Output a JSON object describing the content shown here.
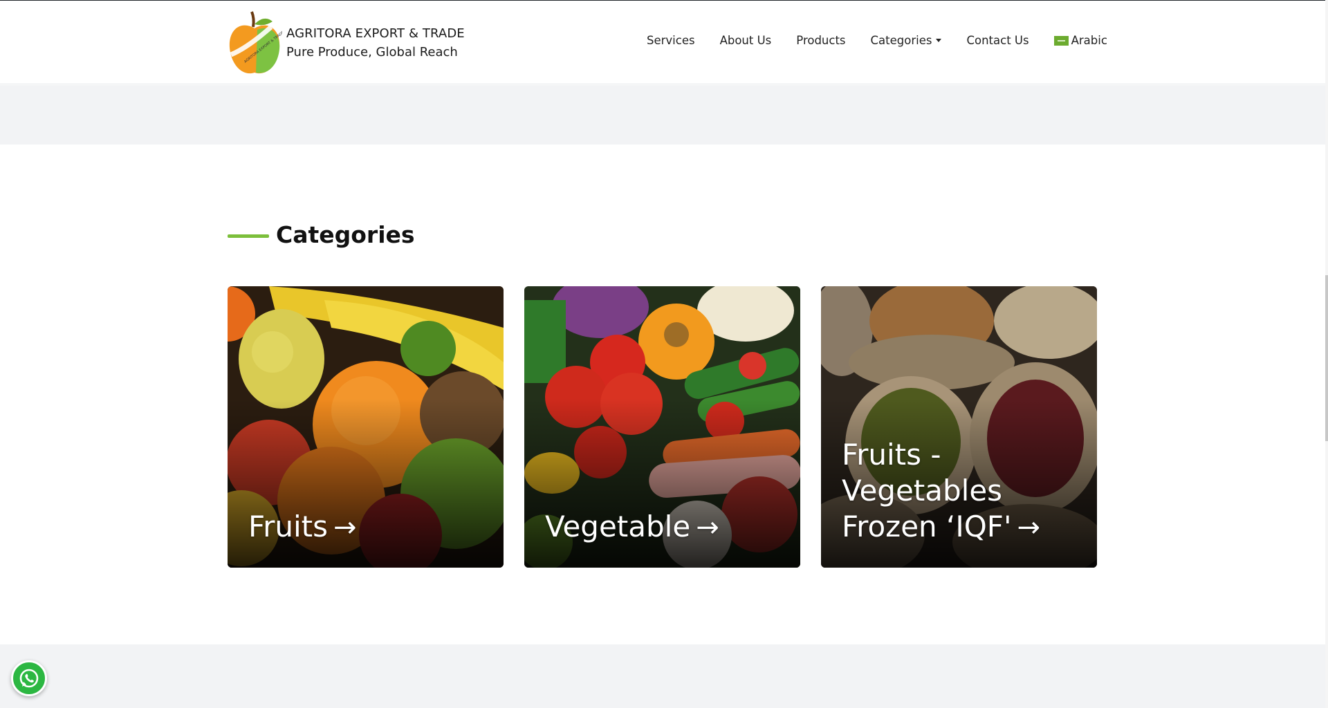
{
  "header": {
    "brand_name": "AGRITORA EXPORT & TRADE",
    "brand_tagline": "Pure Produce, Global Reach",
    "logo_text": "AGRITORA EXPORT & TRADE"
  },
  "nav": {
    "items": [
      {
        "label": "Services"
      },
      {
        "label": "About Us"
      },
      {
        "label": "Products"
      },
      {
        "label": "Categories"
      },
      {
        "label": "Contact Us"
      },
      {
        "label": "Arabic"
      }
    ]
  },
  "section": {
    "title": "Categories"
  },
  "cards": [
    {
      "label": "Fruits"
    },
    {
      "label": "Vegetable"
    },
    {
      "label": "Fruits - Vegetables Frozen ‘IQF'"
    }
  ],
  "icons": {
    "arrow": "→",
    "whatsapp": "whatsapp-icon",
    "flag": "saudi-flag-icon"
  },
  "colors": {
    "accent": "#7cbf3b",
    "whatsapp": "#2cb742"
  }
}
